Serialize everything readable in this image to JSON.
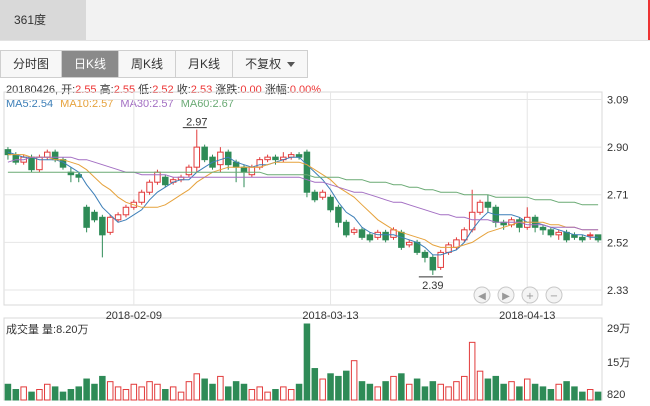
{
  "window": {
    "title": "361度"
  },
  "tabs": [
    {
      "label": "分时图",
      "active": false
    },
    {
      "label": "日K线",
      "active": true
    },
    {
      "label": "周K线",
      "active": false
    },
    {
      "label": "月K线",
      "active": false
    },
    {
      "label": "不复权",
      "active": false,
      "dropdown": true
    }
  ],
  "info": {
    "date": "20180426",
    "open_label": "开:",
    "open": "2.55",
    "high_label": "高:",
    "high": "2.55",
    "low_label": "低:",
    "low": "2.52",
    "close_label": "收:",
    "close": "2.53",
    "change_label": "涨跌:",
    "change": "0.00",
    "pct_label": "涨幅:",
    "pct": "0.00%"
  },
  "ma": [
    {
      "label": "MA5:2.54",
      "color": "#3d7fb8"
    },
    {
      "label": "MA10:2.57",
      "color": "#e6a23c"
    },
    {
      "label": "MA30:2.57",
      "color": "#a36fc3"
    },
    {
      "label": "MA60:2.67",
      "color": "#6aaa74"
    }
  ],
  "colors": {
    "up": "#e23b3b",
    "down": "#2e8b57",
    "grid": "#e6e6e6"
  },
  "price_axis": {
    "min": 2.27,
    "max": 3.12,
    "ticks": [
      "3.09",
      "2.90",
      "2.71",
      "2.52",
      "2.33"
    ]
  },
  "annotations": {
    "high": "2.97",
    "low": "2.39"
  },
  "date_ticks": [
    {
      "label": "2018-02-09",
      "index": 16
    },
    {
      "label": "2018-03-13",
      "index": 41
    },
    {
      "label": "2018-04-13",
      "index": 66
    }
  ],
  "volume": {
    "label": "成交量 量:8.20万",
    "max": 29,
    "ticks": [
      "29万",
      "15万",
      "820"
    ]
  },
  "nav_icons": [
    "prev-icon",
    "next-icon",
    "zoom-in-icon",
    "zoom-out-icon"
  ],
  "chart_data": {
    "type": "candlestick",
    "candles": [
      [
        2.89,
        2.87,
        2.9,
        2.85
      ],
      [
        2.87,
        2.84,
        2.88,
        2.83
      ],
      [
        2.84,
        2.86,
        2.87,
        2.83
      ],
      [
        2.86,
        2.81,
        2.87,
        2.8
      ],
      [
        2.81,
        2.86,
        2.87,
        2.8
      ],
      [
        2.86,
        2.88,
        2.89,
        2.85
      ],
      [
        2.88,
        2.85,
        2.89,
        2.84
      ],
      [
        2.85,
        2.82,
        2.86,
        2.81
      ],
      [
        2.8,
        2.79,
        2.82,
        2.76
      ],
      [
        2.79,
        2.78,
        2.8,
        2.76
      ],
      [
        2.66,
        2.58,
        2.67,
        2.56
      ],
      [
        2.64,
        2.61,
        2.65,
        2.6
      ],
      [
        2.62,
        2.55,
        2.63,
        2.46
      ],
      [
        2.56,
        2.62,
        2.63,
        2.55
      ],
      [
        2.61,
        2.63,
        2.64,
        2.6
      ],
      [
        2.63,
        2.66,
        2.67,
        2.62
      ],
      [
        2.66,
        2.68,
        2.69,
        2.65
      ],
      [
        2.68,
        2.72,
        2.73,
        2.67
      ],
      [
        2.72,
        2.76,
        2.77,
        2.71
      ],
      [
        2.76,
        2.8,
        2.81,
        2.75
      ],
      [
        2.78,
        2.75,
        2.79,
        2.74
      ],
      [
        2.76,
        2.77,
        2.78,
        2.75
      ],
      [
        2.77,
        2.78,
        2.79,
        2.76
      ],
      [
        2.79,
        2.82,
        2.83,
        2.78
      ],
      [
        2.82,
        2.9,
        2.97,
        2.8
      ],
      [
        2.9,
        2.85,
        2.91,
        2.84
      ],
      [
        2.86,
        2.82,
        2.87,
        2.81
      ],
      [
        2.83,
        2.88,
        2.9,
        2.8
      ],
      [
        2.88,
        2.83,
        2.89,
        2.81
      ],
      [
        2.84,
        2.82,
        2.85,
        2.76
      ],
      [
        2.82,
        2.8,
        2.83,
        2.74
      ],
      [
        2.79,
        2.82,
        2.83,
        2.78
      ],
      [
        2.82,
        2.85,
        2.86,
        2.81
      ],
      [
        2.85,
        2.86,
        2.87,
        2.84
      ],
      [
        2.86,
        2.85,
        2.87,
        2.83
      ],
      [
        2.85,
        2.86,
        2.88,
        2.84
      ],
      [
        2.86,
        2.87,
        2.88,
        2.85
      ],
      [
        2.87,
        2.86,
        2.88,
        2.85
      ],
      [
        2.88,
        2.72,
        2.89,
        2.7
      ],
      [
        2.72,
        2.69,
        2.73,
        2.68
      ],
      [
        2.7,
        2.72,
        2.73,
        2.69
      ],
      [
        2.7,
        2.65,
        2.71,
        2.64
      ],
      [
        2.66,
        2.6,
        2.67,
        2.58
      ],
      [
        2.6,
        2.55,
        2.61,
        2.54
      ],
      [
        2.56,
        2.57,
        2.58,
        2.55
      ],
      [
        2.57,
        2.54,
        2.58,
        2.53
      ],
      [
        2.55,
        2.53,
        2.56,
        2.52
      ],
      [
        2.54,
        2.56,
        2.57,
        2.53
      ],
      [
        2.56,
        2.53,
        2.57,
        2.52
      ],
      [
        2.54,
        2.57,
        2.58,
        2.53
      ],
      [
        2.56,
        2.5,
        2.57,
        2.49
      ],
      [
        2.51,
        2.52,
        2.53,
        2.5
      ],
      [
        2.52,
        2.48,
        2.53,
        2.47
      ],
      [
        2.48,
        2.46,
        2.49,
        2.44
      ],
      [
        2.46,
        2.41,
        2.47,
        2.39
      ],
      [
        2.42,
        2.48,
        2.49,
        2.41
      ],
      [
        2.48,
        2.51,
        2.52,
        2.47
      ],
      [
        2.5,
        2.53,
        2.54,
        2.49
      ],
      [
        2.53,
        2.57,
        2.58,
        2.52
      ],
      [
        2.57,
        2.64,
        2.73,
        2.56
      ],
      [
        2.64,
        2.68,
        2.69,
        2.63
      ],
      [
        2.68,
        2.66,
        2.71,
        2.64
      ],
      [
        2.66,
        2.6,
        2.67,
        2.58
      ],
      [
        2.6,
        2.59,
        2.61,
        2.57
      ],
      [
        2.59,
        2.61,
        2.62,
        2.58
      ],
      [
        2.61,
        2.58,
        2.62,
        2.56
      ],
      [
        2.58,
        2.62,
        2.66,
        2.57
      ],
      [
        2.62,
        2.58,
        2.63,
        2.56
      ],
      [
        2.58,
        2.57,
        2.59,
        2.55
      ],
      [
        2.57,
        2.55,
        2.58,
        2.54
      ],
      [
        2.55,
        2.56,
        2.57,
        2.53
      ],
      [
        2.56,
        2.53,
        2.57,
        2.52
      ],
      [
        2.55,
        2.54,
        2.56,
        2.53
      ],
      [
        2.54,
        2.53,
        2.55,
        2.52
      ],
      [
        2.55,
        2.55,
        2.56,
        2.53
      ],
      [
        2.55,
        2.53,
        2.55,
        2.52
      ]
    ],
    "volumes": [
      6,
      4,
      5,
      3,
      4,
      6,
      5,
      3,
      4,
      5,
      8,
      6,
      9,
      7,
      5,
      4,
      6,
      5,
      7,
      6,
      4,
      5,
      3,
      7,
      10,
      8,
      6,
      9,
      5,
      7,
      6,
      4,
      5,
      3,
      4,
      5,
      4,
      6,
      29,
      12,
      8,
      10,
      9,
      11,
      15,
      7,
      6,
      5,
      7,
      9,
      10,
      6,
      8,
      5,
      7,
      6,
      5,
      7,
      9,
      22,
      11,
      8,
      9,
      6,
      7,
      5,
      8,
      6,
      5,
      4,
      6,
      7,
      5,
      3,
      4,
      3
    ],
    "ma_series": [
      {
        "name": "MA5",
        "color": "#3d7fb8",
        "values": [
          2.88,
          2.87,
          2.86,
          2.86,
          2.85,
          2.85,
          2.85,
          2.84,
          2.82,
          2.8,
          2.75,
          2.71,
          2.66,
          2.63,
          2.6,
          2.61,
          2.63,
          2.65,
          2.69,
          2.72,
          2.74,
          2.76,
          2.77,
          2.77,
          2.8,
          2.82,
          2.84,
          2.85,
          2.86,
          2.84,
          2.83,
          2.82,
          2.83,
          2.83,
          2.84,
          2.85,
          2.86,
          2.86,
          2.83,
          2.8,
          2.77,
          2.73,
          2.68,
          2.64,
          2.62,
          2.58,
          2.56,
          2.55,
          2.55,
          2.55,
          2.54,
          2.53,
          2.52,
          2.5,
          2.47,
          2.47,
          2.48,
          2.49,
          2.52,
          2.57,
          2.61,
          2.64,
          2.63,
          2.63,
          2.63,
          2.62,
          2.6,
          2.6,
          2.59,
          2.58,
          2.57,
          2.56,
          2.55,
          2.55,
          2.54,
          2.54
        ]
      },
      {
        "name": "MA10",
        "color": "#e6a23c",
        "values": [
          2.87,
          2.87,
          2.87,
          2.86,
          2.86,
          2.86,
          2.85,
          2.85,
          2.84,
          2.83,
          2.81,
          2.78,
          2.75,
          2.73,
          2.7,
          2.68,
          2.67,
          2.66,
          2.66,
          2.66,
          2.67,
          2.69,
          2.71,
          2.73,
          2.76,
          2.78,
          2.8,
          2.81,
          2.82,
          2.82,
          2.82,
          2.82,
          2.82,
          2.83,
          2.84,
          2.84,
          2.84,
          2.84,
          2.83,
          2.81,
          2.79,
          2.77,
          2.74,
          2.72,
          2.7,
          2.67,
          2.64,
          2.61,
          2.59,
          2.57,
          2.56,
          2.55,
          2.54,
          2.53,
          2.51,
          2.5,
          2.5,
          2.5,
          2.51,
          2.52,
          2.54,
          2.56,
          2.57,
          2.58,
          2.59,
          2.6,
          2.6,
          2.6,
          2.6,
          2.59,
          2.59,
          2.58,
          2.58,
          2.57,
          2.57,
          2.57
        ]
      },
      {
        "name": "MA30",
        "color": "#a36fc3",
        "values": [
          2.84,
          2.85,
          2.85,
          2.86,
          2.86,
          2.86,
          2.86,
          2.86,
          2.86,
          2.85,
          2.85,
          2.84,
          2.83,
          2.82,
          2.81,
          2.8,
          2.8,
          2.79,
          2.79,
          2.79,
          2.79,
          2.78,
          2.78,
          2.78,
          2.78,
          2.78,
          2.78,
          2.78,
          2.78,
          2.78,
          2.78,
          2.78,
          2.78,
          2.78,
          2.78,
          2.78,
          2.78,
          2.78,
          2.77,
          2.76,
          2.76,
          2.75,
          2.74,
          2.73,
          2.72,
          2.72,
          2.71,
          2.7,
          2.69,
          2.68,
          2.68,
          2.67,
          2.66,
          2.65,
          2.64,
          2.63,
          2.63,
          2.62,
          2.62,
          2.61,
          2.61,
          2.61,
          2.6,
          2.6,
          2.6,
          2.6,
          2.59,
          2.59,
          2.59,
          2.58,
          2.58,
          2.58,
          2.58,
          2.57,
          2.57,
          2.57
        ]
      },
      {
        "name": "MA60",
        "color": "#6aaa74",
        "values": [
          2.8,
          2.8,
          2.8,
          2.8,
          2.8,
          2.8,
          2.8,
          2.8,
          2.8,
          2.8,
          2.8,
          2.8,
          2.8,
          2.8,
          2.8,
          2.8,
          2.8,
          2.8,
          2.8,
          2.8,
          2.8,
          2.8,
          2.8,
          2.8,
          2.8,
          2.8,
          2.8,
          2.8,
          2.8,
          2.8,
          2.8,
          2.8,
          2.8,
          2.79,
          2.79,
          2.79,
          2.79,
          2.79,
          2.79,
          2.78,
          2.78,
          2.78,
          2.78,
          2.77,
          2.77,
          2.77,
          2.76,
          2.76,
          2.76,
          2.75,
          2.75,
          2.74,
          2.74,
          2.73,
          2.73,
          2.72,
          2.72,
          2.72,
          2.71,
          2.71,
          2.71,
          2.71,
          2.7,
          2.7,
          2.7,
          2.7,
          2.7,
          2.69,
          2.69,
          2.69,
          2.68,
          2.68,
          2.68,
          2.67,
          2.67,
          2.67
        ]
      }
    ]
  }
}
